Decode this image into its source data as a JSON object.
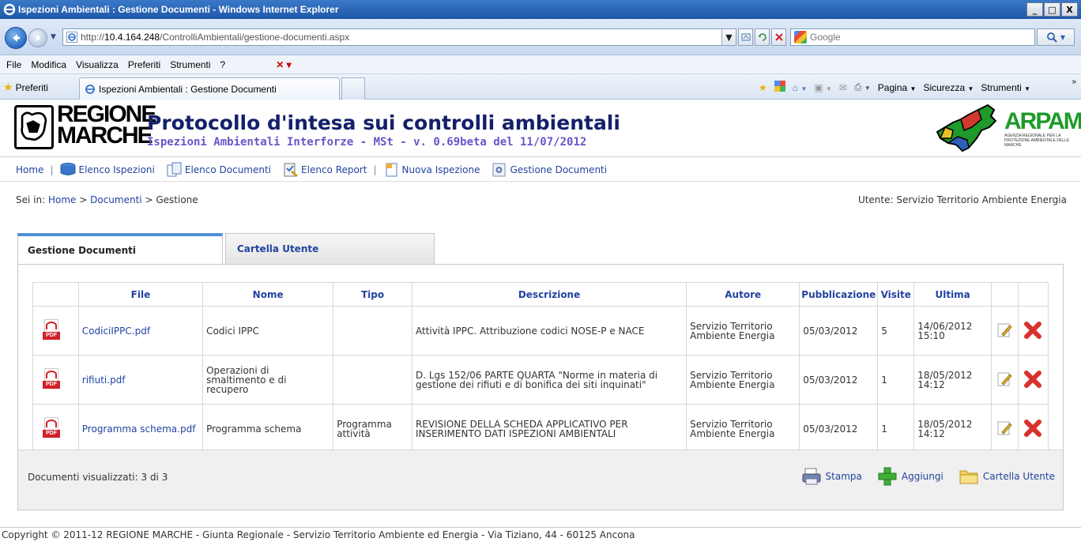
{
  "window": {
    "title": "Ispezioni Ambientali : Gestione Documenti - Windows Internet Explorer",
    "min": "_",
    "max": "□",
    "close": "X"
  },
  "address": {
    "url_prefix": "http://",
    "url_host": "10.4.164.248",
    "url_path": "/ControlliAmbientali/gestione-documenti.aspx",
    "search_placeholder": "Google"
  },
  "menu": {
    "items": [
      "File",
      "Modifica",
      "Visualizza",
      "Preferiti",
      "Strumenti",
      "?"
    ]
  },
  "favbar": {
    "favorites": "Preferiti",
    "tab_title": "Ispezioni Ambientali : Gestione Documenti",
    "pagina": "Pagina",
    "sicurezza": "Sicurezza",
    "strumenti": "Strumenti",
    "more": "»"
  },
  "header": {
    "logo_line1": "REGIONE",
    "logo_line2": "MARCHE",
    "title": "Protocollo d'intesa sui controlli ambientali",
    "subtitle": "Ispezioni Ambientali Interforze - MSt - v. 0.69beta del 11/07/2012",
    "arpam": "ARPAM",
    "arpam_sub": "Agenzia Regionale per la Protezione Ambientale delle Marche"
  },
  "nav": {
    "home": "Home",
    "sep": "|",
    "elenco_ispezioni": "Elenco Ispezioni",
    "elenco_documenti": "Elenco Documenti",
    "elenco_report": "Elenco Report",
    "nuova_ispezione": "Nuova Ispezione",
    "gestione_documenti": "Gestione Documenti"
  },
  "breadcrumb": {
    "prefix": "Sei in:",
    "home": "Home",
    "documenti": "Documenti",
    "gestione": "Gestione",
    "sep": ">"
  },
  "user": "Utente: Servizio Territorio Ambiente Energia",
  "tabs": {
    "active": "Gestione Documenti",
    "other": "Cartella Utente"
  },
  "table": {
    "headers": [
      "File",
      "Nome",
      "Tipo",
      "Descrizione",
      "Autore",
      "Pubblicazione",
      "Visite",
      "Ultima"
    ],
    "rows": [
      {
        "file": "CodiciIPPC.pdf",
        "nome": "Codici IPPC",
        "tipo": "",
        "descrizione": "Attività IPPC. Attribuzione codici NOSE-P e NACE",
        "autore": "Servizio Territorio Ambiente Energia",
        "pubblicazione": "05/03/2012",
        "visite": "5",
        "ultima": "14/06/2012 15:10"
      },
      {
        "file": "rifiuti.pdf",
        "nome": "Operazioni di smaltimento e di recupero",
        "tipo": "",
        "descrizione": "D. Lgs 152/06 PARTE QUARTA \"Norme in materia di gestione dei rifiuti e di bonifica dei siti inquinati\"",
        "autore": "Servizio Territorio Ambiente Energia",
        "pubblicazione": "05/03/2012",
        "visite": "1",
        "ultima": "18/05/2012 14:12"
      },
      {
        "file": "Programma schema.pdf",
        "nome": "Programma schema",
        "tipo": "Programma attività",
        "descrizione": "REVISIONE DELLA SCHEDA APPLICATIVO PER INSERIMENTO DATI ISPEZIONI AMBIENTALI",
        "autore": "Servizio Territorio Ambiente Energia",
        "pubblicazione": "05/03/2012",
        "visite": "1",
        "ultima": "18/05/2012 14:12"
      }
    ],
    "pdf_label": "PDF"
  },
  "footer": {
    "count": "Documenti visualizzati: 3 di 3",
    "stampa": "Stampa",
    "aggiungi": "Aggiungi",
    "cartella": "Cartella Utente"
  },
  "copyright": "Copyright © 2011-12 REGIONE MARCHE - Giunta Regionale - Servizio Territorio Ambiente ed Energia - Via Tiziano, 44 - 60125 Ancona"
}
